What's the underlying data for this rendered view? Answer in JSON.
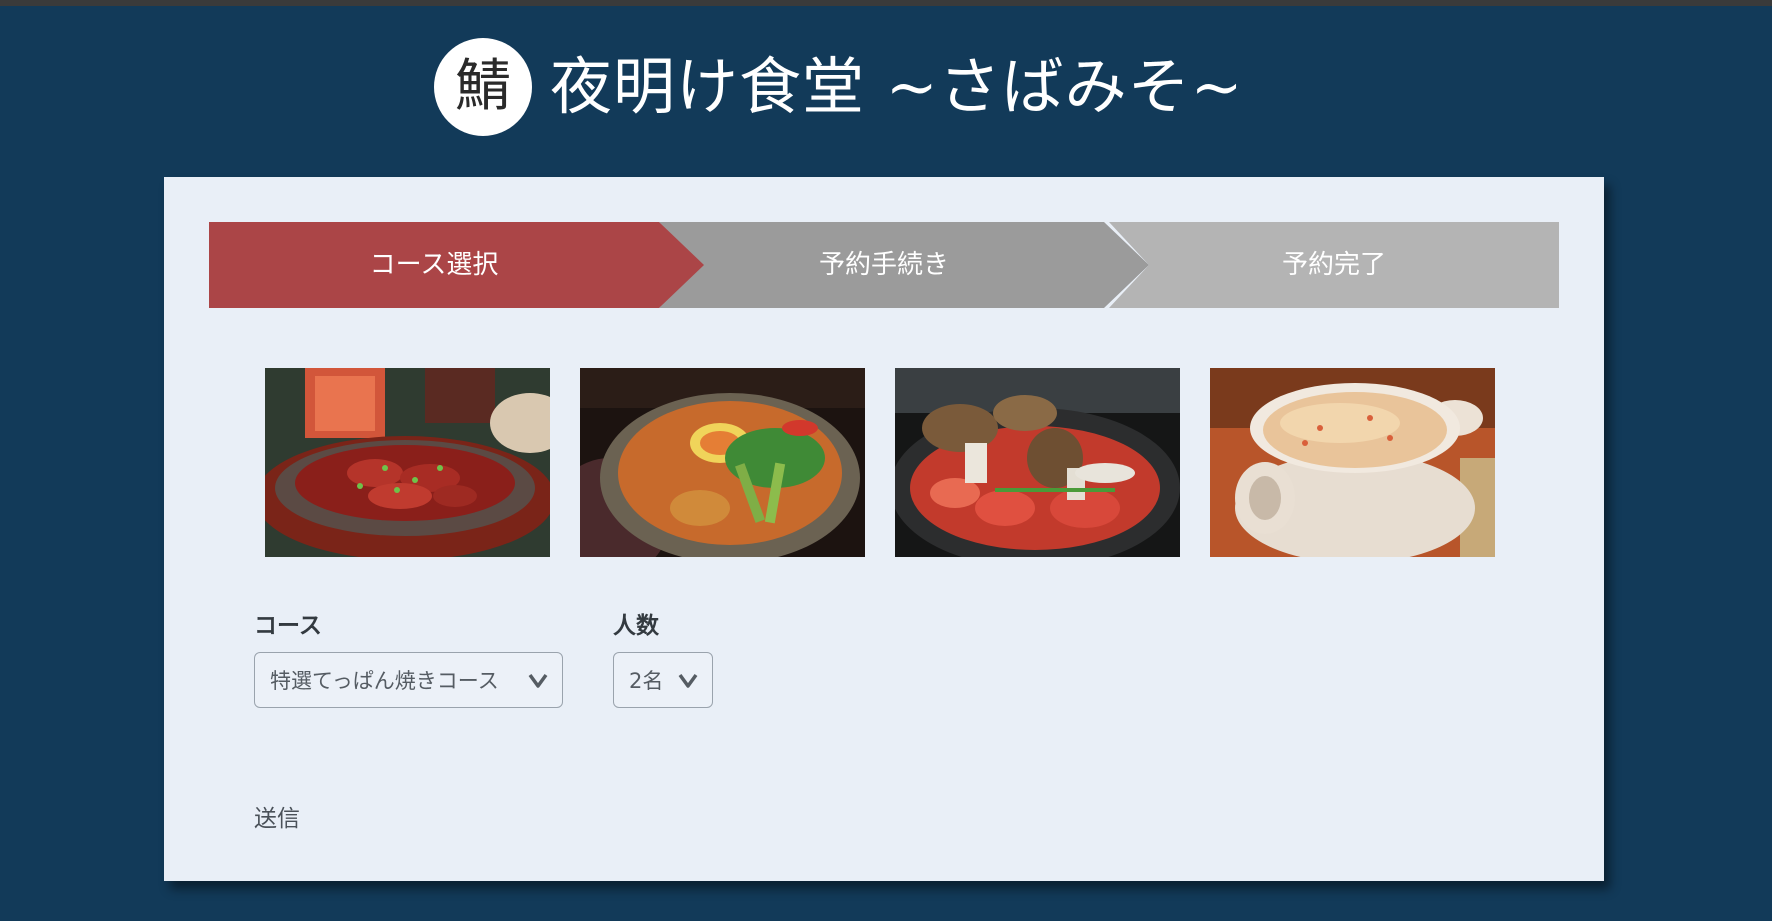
{
  "header": {
    "logo_char": "鯖",
    "title": "夜明け食堂 ~さばみそ~"
  },
  "steps": {
    "items": [
      {
        "label": "コース選択",
        "state": "active",
        "color": "#ab4547"
      },
      {
        "label": "予約手続き",
        "state": "pending",
        "color": "#9b9b9b"
      },
      {
        "label": "予約完了",
        "state": "pending",
        "color": "#b4b4b4"
      }
    ]
  },
  "gallery": {
    "photos": [
      {
        "icon": "sizzling-plate-photo"
      },
      {
        "icon": "clay-pot-stew-photo"
      },
      {
        "icon": "mushroom-tomato-pan-photo"
      },
      {
        "icon": "rice-pot-photo"
      }
    ]
  },
  "form": {
    "course_label": "コース",
    "course_value": "特選てっぱん焼きコース",
    "people_label": "人数",
    "people_value": "2名",
    "submit_label": "送信"
  },
  "colors": {
    "page_bg": "#123a59",
    "card_bg": "#e9eff7",
    "step_active": "#ab4547",
    "step_pending": "#9b9b9b",
    "step_done": "#b4b4b4"
  }
}
